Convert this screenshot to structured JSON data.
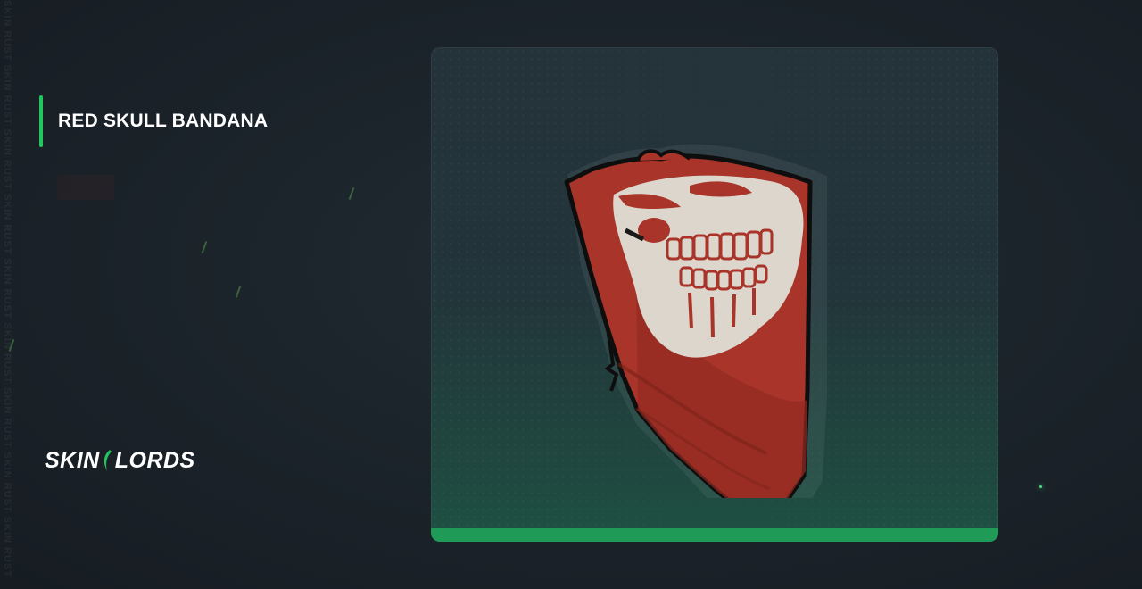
{
  "item": {
    "title": "RED SKULL BANDANA",
    "image_icon": "red-skull-bandana-icon"
  },
  "brand": {
    "logo_left": "SKIN",
    "logo_right": "LORDS",
    "logo_icon": "skinlords-leaf-icon"
  },
  "watermark": {
    "text": "SKIN RUST SKIN RUST SKIN RUST SKIN RUST SKIN RUST SKIN RUST SKIN RUST SKIN RUST SKIN RUST"
  },
  "colors": {
    "accent": "#22c55e",
    "card_bottom": "#1f9a57",
    "bandana_red": "#b3392a",
    "skull_white": "#ddd8cf",
    "background": "#1c242b"
  }
}
